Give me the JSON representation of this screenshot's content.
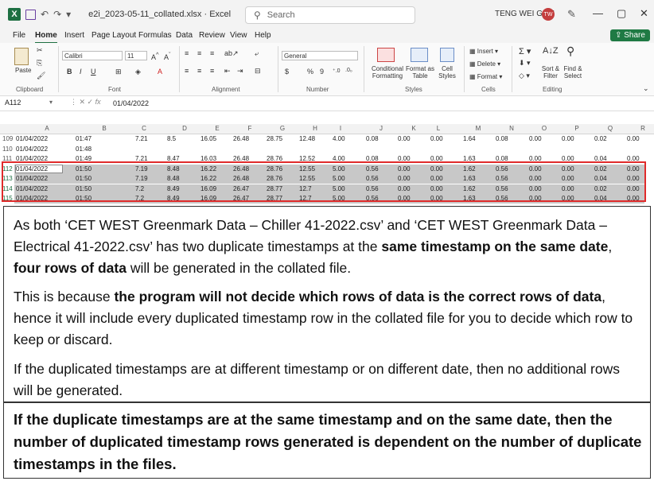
{
  "titlebar": {
    "filename": "e2i_2023-05-11_collated.xlsx",
    "app": "Excel",
    "search_placeholder": "Search",
    "user_name": "TENG WEI GOH",
    "user_initials": "TW"
  },
  "tabs": [
    "File",
    "Home",
    "Insert",
    "Page Layout",
    "Formulas",
    "Data",
    "Review",
    "View",
    "Help"
  ],
  "share_label": "Share",
  "ribbon": {
    "paste": "Paste",
    "clipboard": "Clipboard",
    "font_name": "Calibri",
    "font_size": "11",
    "font_group": "Font",
    "alignment_group": "Alignment",
    "number_format": "General",
    "number_group": "Number",
    "conditional_formatting": "Conditional Formatting",
    "format_as_table": "Format as Table",
    "cell_styles": "Cell Styles",
    "styles_group": "Styles",
    "insert": "Insert",
    "delete": "Delete",
    "format": "Format",
    "cells_group": "Cells",
    "sort_filter": "Sort & Filter",
    "find_select": "Find & Select",
    "editing_group": "Editing"
  },
  "formula_bar": {
    "name_box": "A112",
    "value": "01/04/2022"
  },
  "columns": [
    "A",
    "B",
    "C",
    "D",
    "E",
    "F",
    "G",
    "H",
    "I",
    "J",
    "K",
    "L",
    "M",
    "N",
    "O",
    "P",
    "Q",
    "R"
  ],
  "rows": [
    {
      "num": "109",
      "a": "01/04/2022",
      "b": "01:47",
      "vals": [
        "7.21",
        "8.5",
        "16.05",
        "26.48",
        "28.75",
        "12.48",
        "4.00",
        "0.08",
        "0.00",
        "0.00",
        "1.64",
        "0.08",
        "0.00",
        "0.00",
        "0.02",
        "0.00"
      ]
    },
    {
      "num": "110",
      "a": "01/04/2022",
      "b": "01:48",
      "vals": []
    },
    {
      "num": "111",
      "a": "01/04/2022",
      "b": "01:49",
      "vals": [
        "7.21",
        "8.47",
        "16.03",
        "26.48",
        "28.76",
        "12.52",
        "4.00",
        "0.08",
        "0.00",
        "0.00",
        "1.63",
        "0.08",
        "0.00",
        "0.00",
        "0.04",
        "0.00"
      ]
    },
    {
      "num": "112",
      "a": "01/04/2022",
      "b": "01:50",
      "vals": [
        "7.19",
        "8.48",
        "16.22",
        "26.48",
        "28.76",
        "12.55",
        "5.00",
        "0.56",
        "0.00",
        "0.00",
        "1.62",
        "0.56",
        "0.00",
        "0.00",
        "0.02",
        "0.00"
      ]
    },
    {
      "num": "113",
      "a": "01/04/2022",
      "b": "01:50",
      "vals": [
        "7.19",
        "8.48",
        "16.22",
        "26.48",
        "28.76",
        "12.55",
        "5.00",
        "0.56",
        "0.00",
        "0.00",
        "1.63",
        "0.56",
        "0.00",
        "0.00",
        "0.04",
        "0.00"
      ]
    },
    {
      "num": "114",
      "a": "01/04/2022",
      "b": "01:50",
      "vals": [
        "7.2",
        "8.49",
        "16.09",
        "26.47",
        "28.77",
        "12.7",
        "5.00",
        "0.56",
        "0.00",
        "0.00",
        "1.62",
        "0.56",
        "0.00",
        "0.00",
        "0.02",
        "0.00"
      ]
    },
    {
      "num": "115",
      "a": "01/04/2022",
      "b": "01:50",
      "vals": [
        "7.2",
        "8.49",
        "16.09",
        "26.47",
        "28.77",
        "12.7",
        "5.00",
        "0.56",
        "0.00",
        "0.00",
        "1.63",
        "0.56",
        "0.00",
        "0.00",
        "0.04",
        "0.00"
      ]
    }
  ],
  "explanation": {
    "p1_a": "As both ‘CET WEST Greenmark Data – Chiller 41-2022.csv’ and ‘CET WEST Greenmark Data – Electrical 41-2022.csv’ has two duplicate timestamps at the ",
    "p1_b": "same timestamp on the same date",
    "p1_c": ", ",
    "p1_d": "four rows of data",
    "p1_e": " will be generated in the collated file.",
    "p2_a": "This is because ",
    "p2_b": "the program will not decide which rows of data is the correct rows of data",
    "p2_c": ", hence it will include every duplicated timestamp row in the collated file for you to decide which row to keep or discard.",
    "p3": "If the duplicated timestamps are at different timestamp or on different date, then no additional rows will be generated.",
    "conclusion": "If the duplicate timestamps are at the same timestamp and on the same date, then the number of duplicated timestamp rows generated is dependent on the number of duplicate timestamps in the files."
  }
}
